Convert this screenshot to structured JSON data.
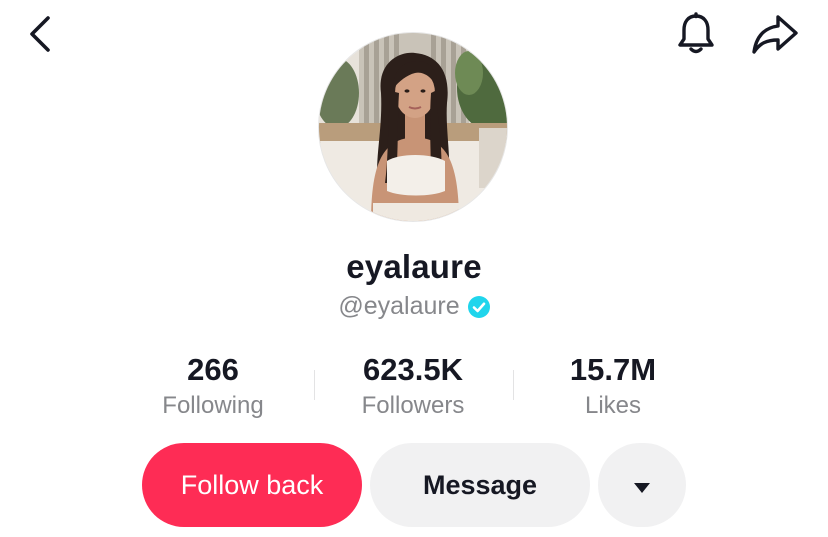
{
  "header": {
    "back_icon": "chevron-left-icon",
    "bell_icon": "bell-icon",
    "share_icon": "share-arrow-icon"
  },
  "profile": {
    "display_name": "eyalaure",
    "handle": "@eyalaure",
    "verified": true,
    "verified_color": "#20d5ec"
  },
  "stats": {
    "following": {
      "value": "266",
      "label": "Following"
    },
    "followers": {
      "value": "623.5K",
      "label": "Followers"
    },
    "likes": {
      "value": "15.7M",
      "label": "Likes"
    }
  },
  "actions": {
    "follow_back_label": "Follow back",
    "message_label": "Message",
    "more_icon": "caret-down-icon"
  },
  "colors": {
    "primary": "#fe2c55",
    "text": "#161823",
    "secondary_text": "#86878b",
    "button_gray": "#f1f1f2"
  }
}
